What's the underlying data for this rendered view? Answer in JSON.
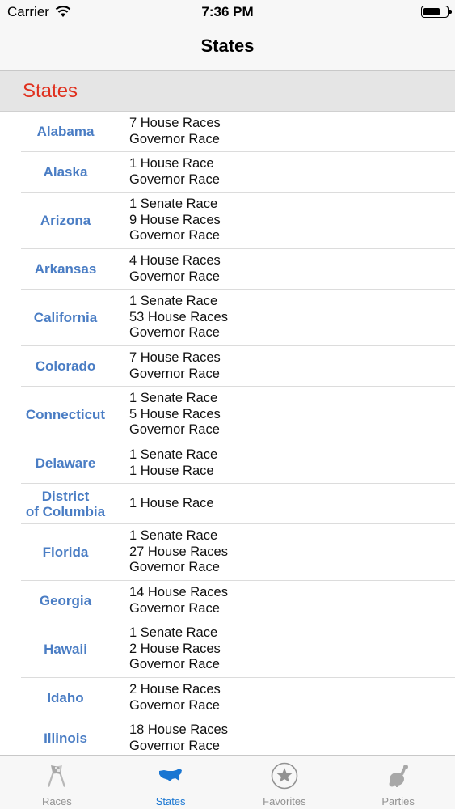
{
  "status_bar": {
    "carrier": "Carrier",
    "time": "7:36 PM",
    "battery_level": 0.75
  },
  "nav": {
    "title": "States"
  },
  "section": {
    "title": "States"
  },
  "states": [
    {
      "name": "Alabama",
      "races": [
        "7 House Races",
        "Governor Race"
      ]
    },
    {
      "name": "Alaska",
      "races": [
        "1 House Race",
        "Governor Race"
      ]
    },
    {
      "name": "Arizona",
      "races": [
        "1 Senate Race",
        "9 House Races",
        "Governor Race"
      ]
    },
    {
      "name": "Arkansas",
      "races": [
        "4 House Races",
        "Governor Race"
      ]
    },
    {
      "name": "California",
      "races": [
        "1 Senate Race",
        "53 House Races",
        "Governor Race"
      ]
    },
    {
      "name": "Colorado",
      "races": [
        "7 House Races",
        "Governor Race"
      ]
    },
    {
      "name": "Connecticut",
      "races": [
        "1 Senate Race",
        "5 House Races",
        "Governor Race"
      ]
    },
    {
      "name": "Delaware",
      "races": [
        "1 Senate Race",
        "1 House Race"
      ]
    },
    {
      "name": "District\nof Columbia",
      "races": [
        "1 House Race"
      ]
    },
    {
      "name": "Florida",
      "races": [
        "1 Senate Race",
        "27 House Races",
        "Governor Race"
      ]
    },
    {
      "name": "Georgia",
      "races": [
        "14 House Races",
        "Governor Race"
      ]
    },
    {
      "name": "Hawaii",
      "races": [
        "1 Senate Race",
        "2 House Races",
        "Governor Race"
      ]
    },
    {
      "name": "Idaho",
      "races": [
        "2 House Races",
        "Governor Race"
      ]
    },
    {
      "name": "Illinois",
      "races": [
        "18 House Races",
        "Governor Race"
      ]
    }
  ],
  "tabs": [
    {
      "label": "Races",
      "icon": "checkered-flags-icon",
      "active": false
    },
    {
      "label": "States",
      "icon": "usa-map-icon",
      "active": true
    },
    {
      "label": "Favorites",
      "icon": "star-circle-icon",
      "active": false
    },
    {
      "label": "Parties",
      "icon": "party-animals-icon",
      "active": false
    }
  ],
  "colors": {
    "accent": "#1976d2",
    "section_title": "#e0301e",
    "state_name": "#4a7dc4",
    "inactive_tab": "#929292"
  }
}
